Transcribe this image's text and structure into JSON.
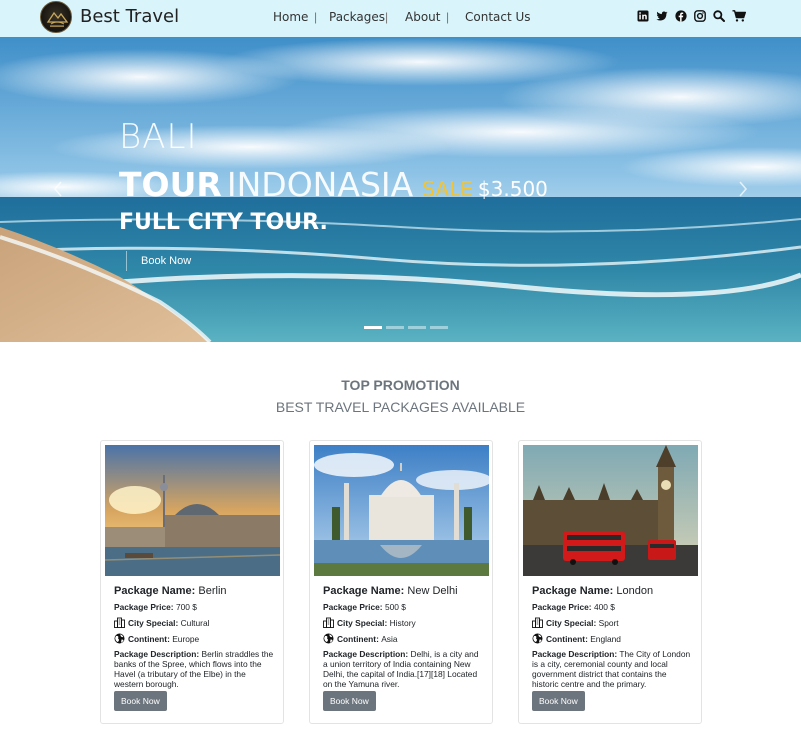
{
  "navbar": {
    "brand": "Best Travel",
    "links": [
      {
        "label": "Home"
      },
      {
        "label": "Packages"
      },
      {
        "label": "About"
      },
      {
        "label": "Contact Us"
      }
    ],
    "separator": "|",
    "icons": [
      "linkedin-icon",
      "twitter-icon",
      "facebook-icon",
      "instagram-icon",
      "search-icon",
      "cart-icon"
    ],
    "background": "#d9f4fb"
  },
  "hero": {
    "line1": "BALI",
    "tour_word": "TOUR",
    "destination": "INDONASIA",
    "sale_label": "SALE",
    "price": "$3.500",
    "line3": "FULL CITY TOUR.",
    "book_label": "Book Now",
    "sale_color": "#f4c430",
    "indicator_count": 4,
    "active_indicator": 0
  },
  "promo": {
    "title": "TOP PROMOTION",
    "subtitle": "BEST TRAVEL PACKAGES AVAILABLE"
  },
  "cards": [
    {
      "name_label": "Package Name:",
      "name": "Berlin",
      "price_label": "Package Price:",
      "price": "700 $",
      "special_label": "City Special:",
      "special": "Cultural",
      "continent_label": "Continent:",
      "continent": "Europe",
      "desc_label": "Package Description:",
      "desc": "Berlin straddles the banks of the Spree, which flows into the Havel (a tributary of the Elbe) in the western borough.",
      "button": "Book Now"
    },
    {
      "name_label": "Package Name:",
      "name": "New Delhi",
      "price_label": "Package Price:",
      "price": "500 $",
      "special_label": "City Special:",
      "special": "History",
      "continent_label": "Continent:",
      "continent": "Asia",
      "desc_label": "Package Description:",
      "desc": "Delhi, is a city and a union territory of India containing New Delhi, the capital of India.[17][18] Located on the Yamuna river.",
      "button": "Book Now"
    },
    {
      "name_label": "Package Name:",
      "name": "London",
      "price_label": "Package Price:",
      "price": "400 $",
      "special_label": "City Special:",
      "special": "Sport",
      "continent_label": "Continent:",
      "continent": "England",
      "desc_label": "Package Description:",
      "desc": "The City of London is a city, ceremonial county and local government district that contains the historic centre and the primary.",
      "button": "Book Now"
    }
  ],
  "colors": {
    "button": "#6c757d",
    "heading": "#6c757d"
  }
}
